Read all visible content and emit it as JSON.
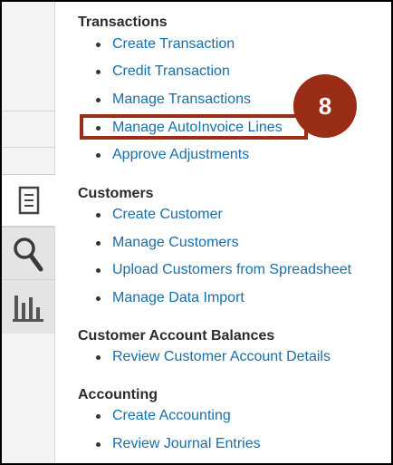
{
  "sections": [
    {
      "title": "Transactions",
      "items": [
        "Create Transaction",
        "Credit Transaction",
        "Manage Transactions",
        "Manage AutoInvoice Lines",
        "Approve Adjustments"
      ]
    },
    {
      "title": "Customers",
      "items": [
        "Create Customer",
        "Manage Customers",
        "Upload Customers from Spreadsheet",
        "Manage Data Import"
      ]
    },
    {
      "title": "Customer Account Balances",
      "items": [
        "Review Customer Account Details"
      ]
    },
    {
      "title": "Accounting",
      "items": [
        "Create Accounting",
        "Review Journal Entries"
      ]
    }
  ],
  "callout": {
    "label": "8"
  },
  "sidebar_tabs": [
    "task-list-icon",
    "search-icon",
    "bar-chart-icon"
  ],
  "colors": {
    "link": "#1a6ea8",
    "accent": "#9a2d16"
  }
}
